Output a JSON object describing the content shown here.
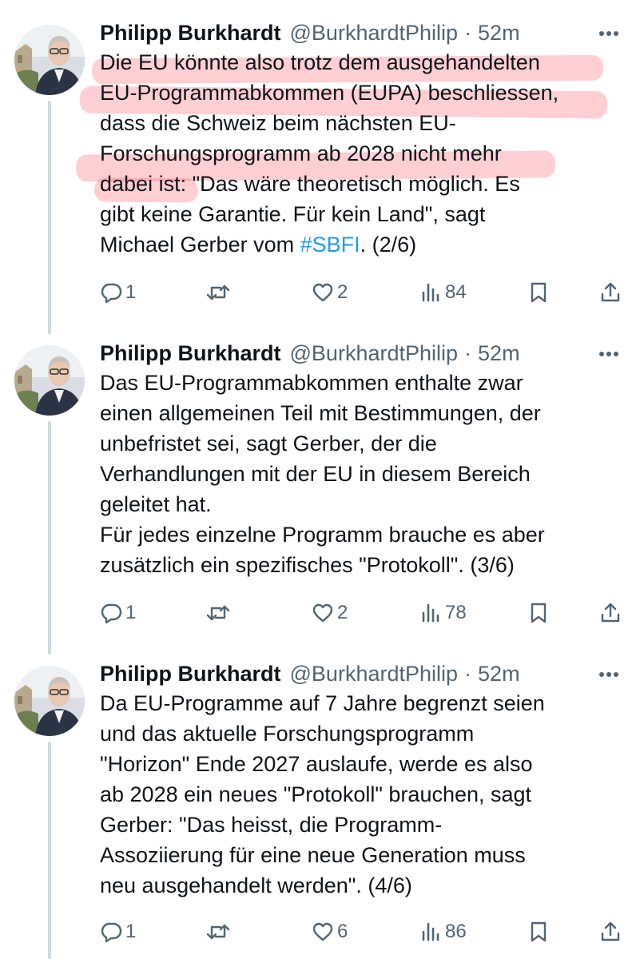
{
  "tweets": [
    {
      "author": {
        "name": "Philipp Burkhardt",
        "handle": "@BurkhardtPhilip",
        "separator": "·",
        "time": "52m"
      },
      "lines": [
        "Die EU könnte also trotz dem ausgehandelten",
        "EU-Programmabkommen (EUPA) beschliessen,",
        "dass die Schweiz  beim nächsten EU-",
        "Forschungsprogramm ab 2028 nicht mehr",
        "dabei ist: \"Das  wäre theoretisch möglich. Es",
        "gibt keine Garantie. Für kein Land\", sagt"
      ],
      "last_line": {
        "before": "Michael Gerber vom ",
        "hashtag": "#SBFI",
        "after": ". (2/6)"
      },
      "stats": {
        "replies": "1",
        "reposts": "",
        "likes": "2",
        "views": "84"
      }
    },
    {
      "author": {
        "name": "Philipp Burkhardt",
        "handle": "@BurkhardtPhilip",
        "separator": "·",
        "time": "52m"
      },
      "lines": [
        "Das EU-Programmabkommen enthalte zwar",
        "einen allgemeinen Teil mit Bestimmungen, der",
        "unbefristet sei, sagt Gerber, der die",
        "Verhandlungen mit der EU in diesem Bereich",
        "geleitet hat.",
        "Für jedes einzelne Programm brauche es aber",
        "zusätzlich ein spezifisches \"Protokoll\". (3/6)"
      ],
      "stats": {
        "replies": "1",
        "reposts": "",
        "likes": "2",
        "views": "78"
      }
    },
    {
      "author": {
        "name": "Philipp Burkhardt",
        "handle": "@BurkhardtPhilip",
        "separator": "·",
        "time": "52m"
      },
      "lines": [
        "Da EU-Programme auf 7 Jahre begrenzt seien",
        "und das aktuelle Forschungsprogramm",
        "\"Horizon\" Ende 2027 auslaufe, werde es also",
        "ab 2028 ein neues \"Protokoll\" brauchen, sagt",
        "Gerber: \"Das heisst, die Programm-",
        "Assoziierung für eine neue Generation muss",
        "neu ausgehandelt werden\". (4/6)"
      ],
      "stats": {
        "replies": "1",
        "reposts": "",
        "likes": "6",
        "views": "86"
      }
    }
  ],
  "icons": {
    "more": "more-horizontal-icon",
    "reply": "reply-bubble-icon",
    "repost": "repost-arrows-icon",
    "like": "heart-icon",
    "views": "views-bars-icon",
    "bookmark": "bookmark-icon",
    "share": "share-upload-icon"
  },
  "colors": {
    "text": "#0f1419",
    "secondary": "#536471",
    "hashtag": "#1d9bf0",
    "thread_line": "#cfd9de",
    "highlight": "#ff4655"
  }
}
